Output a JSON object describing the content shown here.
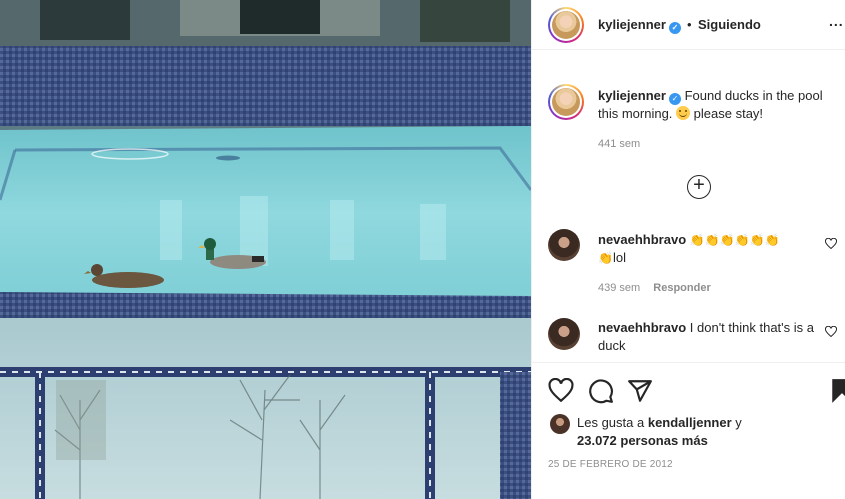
{
  "post": {
    "username": "kyliejenner",
    "separator": "•",
    "follow_status": "Siguiendo",
    "options_label": "...",
    "caption": {
      "username": "kyliejenner",
      "text_before_emoji": "Found ducks in the pool this morning.",
      "emoji_name": "smiling-face-emoji",
      "text_after_emoji": "please stay!",
      "time": "441 sem"
    },
    "load_more_label": "+",
    "comments": [
      {
        "username": "nevaehhbravo",
        "claps": "👏👏👏👏👏👏",
        "clap_2": "👏",
        "text": "lol",
        "time": "439 sem",
        "reply_label": "Responder"
      },
      {
        "username": "nevaehhbravo",
        "text": "I don't think that's is a duck"
      }
    ],
    "likes": {
      "prefix": "Les gusta a",
      "first_user": "kendalljenner",
      "connector": "y",
      "count_text": "23.072 personas más"
    },
    "date": "25 DE FEBRERO DE 2012",
    "icons": [
      "heart-icon",
      "comment-icon",
      "share-icon",
      "bookmark-icon",
      "verified-badge-icon",
      "add-circle-icon"
    ]
  }
}
